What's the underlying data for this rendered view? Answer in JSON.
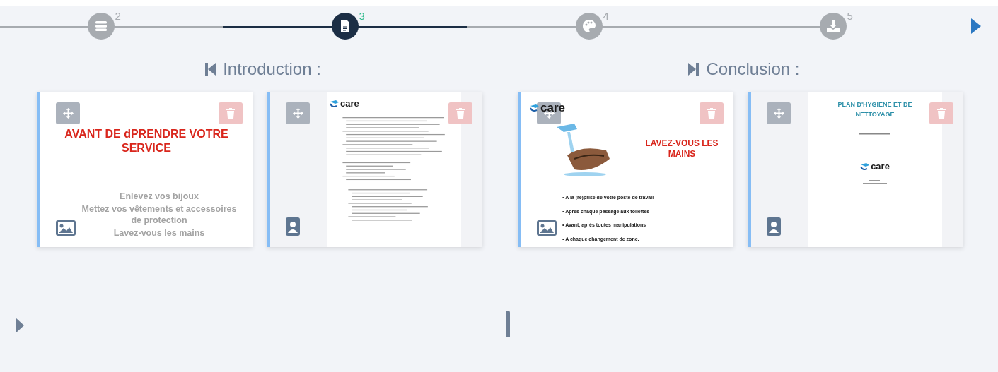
{
  "steps": [
    {
      "number": "2",
      "selected": false
    },
    {
      "number": "3",
      "selected": true
    },
    {
      "number": "4",
      "selected": false
    },
    {
      "number": "5",
      "selected": false
    }
  ],
  "sections": [
    {
      "title": "Introduction :",
      "cards": [
        {
          "kind": "slide",
          "title": "AVANT DE dPRENDRE VOTRE SERVICE",
          "lines": [
            "Enlevez vos bijoux",
            "Mettez vos vêtements et accessoires de protection",
            "Lavez-vous les mains"
          ]
        },
        {
          "kind": "document",
          "logo": "care"
        }
      ]
    },
    {
      "title": "Conclusion :",
      "cards": [
        {
          "kind": "photo-slide",
          "logo": "care",
          "title": "LAVEZ-VOUS LES MAINS",
          "bullets": [
            "• A la (re)prise de votre poste de travail",
            "• Après chaque passage aux toilettes",
            "• Avant, après toutes manipulations",
            "• A chaque changement de zone."
          ]
        },
        {
          "kind": "document",
          "title": "PLAN D'HYGIENE ET DE NETTOYAGE",
          "logo": "care"
        }
      ]
    }
  ]
}
